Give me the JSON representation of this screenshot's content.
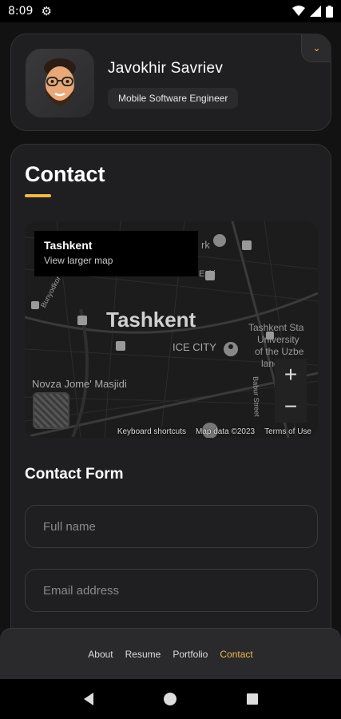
{
  "status": {
    "time": "8:09"
  },
  "profile": {
    "name": "Javokhir Savriev",
    "title": "Mobile Software Engineer"
  },
  "contact": {
    "title": "Contact",
    "map": {
      "popup_place": "Tashkent",
      "popup_link": "View larger map",
      "city": "Tashkent",
      "labels": {
        "ice_city": "ICE CITY",
        "novza": "Novza Jome' Masjidi",
        "univ_1": "Tashkent Sta",
        "univ_2": "University",
        "univ_3": "of the Uzbe",
        "univ_4": "langua",
        "bunyodkor": "Bunyodkor Avenue",
        "babur": "Babur Street",
        "park": "rk",
        "eski": "Eski"
      },
      "zoom_in": "+",
      "zoom_out": "−",
      "footer": {
        "shortcuts": "Keyboard shortcuts",
        "map_data": "Map data ©2023",
        "terms": "Terms of Use"
      }
    },
    "form": {
      "title": "Contact Form",
      "full_name_placeholder": "Full name",
      "email_placeholder": "Email address"
    }
  },
  "nav": {
    "about": "About",
    "resume": "Resume",
    "portfolio": "Portfolio",
    "contact": "Contact"
  },
  "colors": {
    "accent": "#f0b84a",
    "card": "#1f1f21",
    "background": "#121212"
  }
}
